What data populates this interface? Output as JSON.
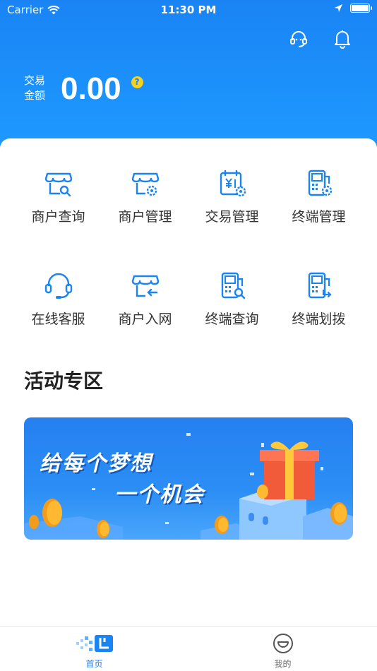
{
  "status_bar": {
    "carrier": "Carrier",
    "time": "11:30 PM"
  },
  "header": {
    "amount_label": "交易金额",
    "amount_value": "0.00",
    "help_symbol": "?",
    "icons": [
      "headset-icon",
      "bell-icon"
    ]
  },
  "menu": {
    "items": [
      {
        "label": "商户查询",
        "icon": "merchant-search-icon"
      },
      {
        "label": "商户管理",
        "icon": "merchant-settings-icon"
      },
      {
        "label": "交易管理",
        "icon": "transaction-settings-icon"
      },
      {
        "label": "终端管理",
        "icon": "terminal-settings-icon"
      },
      {
        "label": "在线客服",
        "icon": "headset-icon"
      },
      {
        "label": "商户入网",
        "icon": "merchant-join-icon"
      },
      {
        "label": "终端查询",
        "icon": "terminal-search-icon"
      },
      {
        "label": "终端划拨",
        "icon": "terminal-transfer-icon"
      }
    ]
  },
  "activity": {
    "title": "活动专区",
    "banner": {
      "line1": "给每个梦想",
      "line2": "一个机会"
    }
  },
  "tabbar": {
    "tabs": [
      {
        "label": "首页",
        "icon": "home-icon",
        "active": true
      },
      {
        "label": "我的",
        "icon": "profile-smile-icon",
        "active": false
      }
    ]
  },
  "colors": {
    "primary": "#1a84f5",
    "accent_yellow": "#f6d21e",
    "banner_gift": "#f25b3a"
  }
}
